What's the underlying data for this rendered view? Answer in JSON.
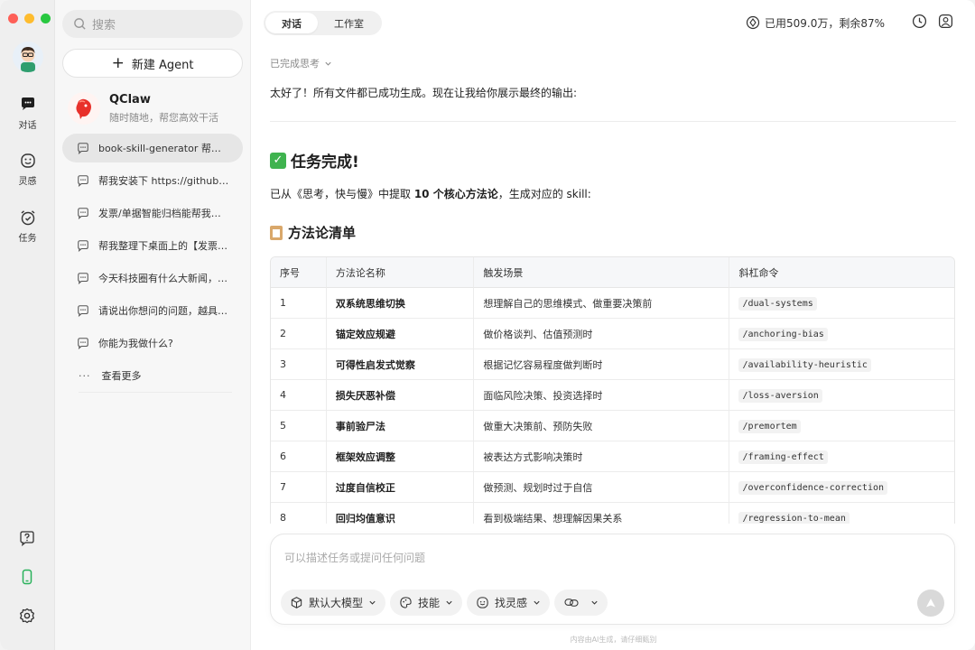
{
  "rail": {
    "items": [
      {
        "label": "对话",
        "icon": "chat-bubble-icon"
      },
      {
        "label": "灵感",
        "icon": "smile-icon"
      },
      {
        "label": "任务",
        "icon": "alarm-clock-icon"
      }
    ],
    "bottom_icons": [
      "help-icon",
      "phone-icon",
      "settings-icon"
    ],
    "accent": "#28b15a"
  },
  "sidebar": {
    "search_placeholder": "搜索",
    "new_agent_label": "新建 Agent",
    "agent": {
      "name": "QClaw",
      "tagline": "随时随地，帮您高效干活"
    },
    "conversations": [
      "book-skill-generator 帮我…",
      "帮我安装下 https://github.…",
      "发票/单据智能归档能帮我…",
      "帮我整理下桌面上的【发票…",
      "今天科技圈有什么大新闻，…",
      "请说出你想问的问题，越具…",
      "你能为我做什么?"
    ],
    "more_label": "查看更多"
  },
  "header": {
    "tabs": [
      {
        "label": "对话"
      },
      {
        "label": "工作室"
      }
    ],
    "usage": "已用509.0万，剩余87%"
  },
  "chat": {
    "thinking_label": "已完成思考",
    "intro": "太好了！所有文件都已成功生成。现在让我给你展示最终的输出:",
    "done_title": "任务完成!",
    "summary_pre": "已从《思考，快与慢》中提取 ",
    "summary_bold": "10 个核心方法论",
    "summary_post": "，生成对应的 skill:",
    "list_title": "方法论清单",
    "table": {
      "headers": [
        "序号",
        "方法论名称",
        "触发场景",
        "斜杠命令"
      ],
      "rows": [
        [
          "1",
          "双系统思维切换",
          "想理解自己的思维模式、做重要决策前",
          "/dual-systems"
        ],
        [
          "2",
          "锚定效应规避",
          "做价格谈判、估值预测时",
          "/anchoring-bias"
        ],
        [
          "3",
          "可得性启发式觉察",
          "根据记忆容易程度做判断时",
          "/availability-heuristic"
        ],
        [
          "4",
          "损失厌恶补偿",
          "面临风险决策、投资选择时",
          "/loss-aversion"
        ],
        [
          "5",
          "事前验尸法",
          "做重大决策前、预防失败",
          "/premortem"
        ],
        [
          "6",
          "框架效应调整",
          "被表达方式影响决策时",
          "/framing-effect"
        ],
        [
          "7",
          "过度自信校正",
          "做预测、规划时过于自信",
          "/overconfidence-correction"
        ],
        [
          "8",
          "回归均值意识",
          "看到极端结果、想理解因果关系",
          "/regression-to-mean"
        ]
      ]
    }
  },
  "composer": {
    "placeholder": "可以描述任务或提问任何问题",
    "chips": [
      {
        "label": "默认大模型",
        "icon": "cube-icon"
      },
      {
        "label": "技能",
        "icon": "palette-icon"
      },
      {
        "label": "找灵感",
        "icon": "smile-icon"
      },
      {
        "label": "",
        "icon": "link-icon"
      }
    ],
    "footnote": "内容由AI生成，请仔细甄别"
  }
}
